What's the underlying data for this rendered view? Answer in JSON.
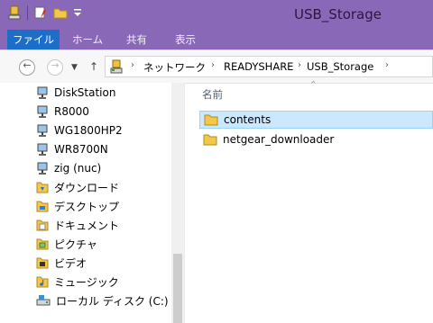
{
  "window": {
    "title": "USB_Storage"
  },
  "ribbon": {
    "tabs": [
      "ファイル",
      "ホーム",
      "共有",
      "表示"
    ]
  },
  "address": {
    "crumbs": [
      "ネットワーク",
      "READYSHARE",
      "USB_Storage"
    ]
  },
  "nav": {
    "items": [
      {
        "label": "DiskStation",
        "icon": "network-computer-icon"
      },
      {
        "label": "R8000",
        "icon": "network-computer-icon"
      },
      {
        "label": "WG1800HP2",
        "icon": "network-computer-icon"
      },
      {
        "label": "WR8700N",
        "icon": "network-computer-icon"
      },
      {
        "label": "zig (nuc)",
        "icon": "network-computer-icon"
      },
      {
        "label": "ダウンロード",
        "icon": "downloads-folder-icon"
      },
      {
        "label": "デスクトップ",
        "icon": "desktop-folder-icon"
      },
      {
        "label": "ドキュメント",
        "icon": "documents-folder-icon"
      },
      {
        "label": "ピクチャ",
        "icon": "pictures-folder-icon"
      },
      {
        "label": "ビデオ",
        "icon": "videos-folder-icon"
      },
      {
        "label": "ミュージック",
        "icon": "music-folder-icon"
      },
      {
        "label": "ローカル ディスク (C:)",
        "icon": "local-disk-icon"
      }
    ]
  },
  "content": {
    "column_header": "名前",
    "files": [
      {
        "name": "contents",
        "selected": true
      },
      {
        "name": "netgear_downloader",
        "selected": false
      }
    ]
  },
  "colors": {
    "titlebar": "#8a68b8",
    "file_tab": "#1c6ec8",
    "selection": "#cce8ff"
  }
}
